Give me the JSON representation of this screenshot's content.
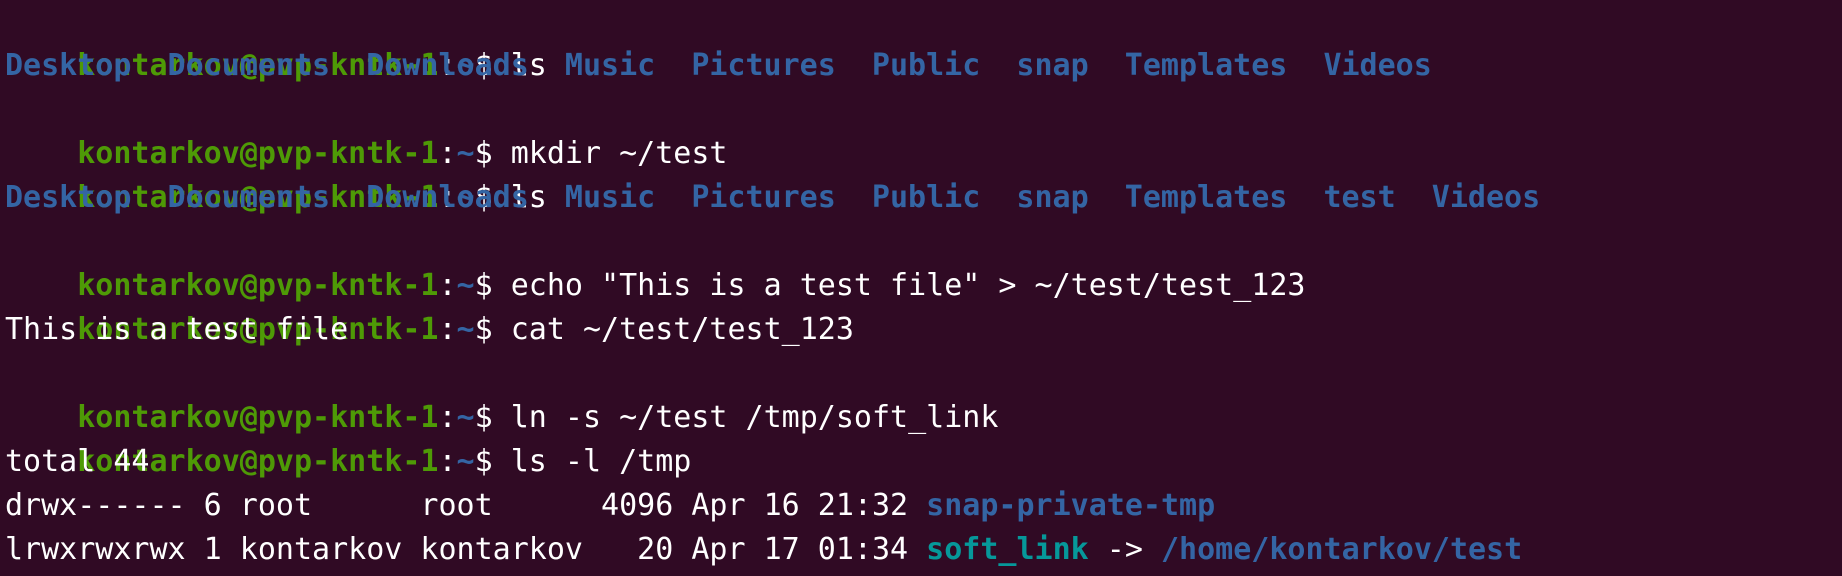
{
  "prompt": {
    "user_host": "kontarkov@pvp-kntk-1",
    "sep": ":",
    "path": "~",
    "symbol": "$ "
  },
  "commands": {
    "c1": "ls",
    "c2": "mkdir ~/test",
    "c3": "ls",
    "c4": "echo \"This is a test file\" > ~/test/test_123",
    "c5": "cat ~/test/test_123",
    "c6": "ln -s ~/test /tmp/soft_link",
    "c7": "ls -l /tmp"
  },
  "ls1": [
    "Desktop",
    "Documents",
    "Downloads",
    "Music",
    "Pictures",
    "Public",
    "snap",
    "Templates",
    "Videos"
  ],
  "ls2": [
    "Desktop",
    "Documents",
    "Downloads",
    "Music",
    "Pictures",
    "Public",
    "snap",
    "Templates",
    "test",
    "Videos"
  ],
  "cat_output": "This is a test file",
  "ls_l": {
    "total": "total 44",
    "rows": [
      {
        "meta": "drwx------ 6 root      root      4096 Apr 16 21:32 ",
        "name": "snap-private-tmp"
      },
      {
        "meta": "lrwxrwxrwx 1 kontarkov kontarkov   20 Apr 17 01:34 ",
        "name": "soft_link",
        "arrow": " -> ",
        "target": "/home/kontarkov/test"
      }
    ]
  },
  "colors": {
    "background": "#300a24",
    "prompt_user": "#4e9a06",
    "directory": "#3465a4",
    "symlink": "#06989a",
    "text": "#ffffff"
  }
}
